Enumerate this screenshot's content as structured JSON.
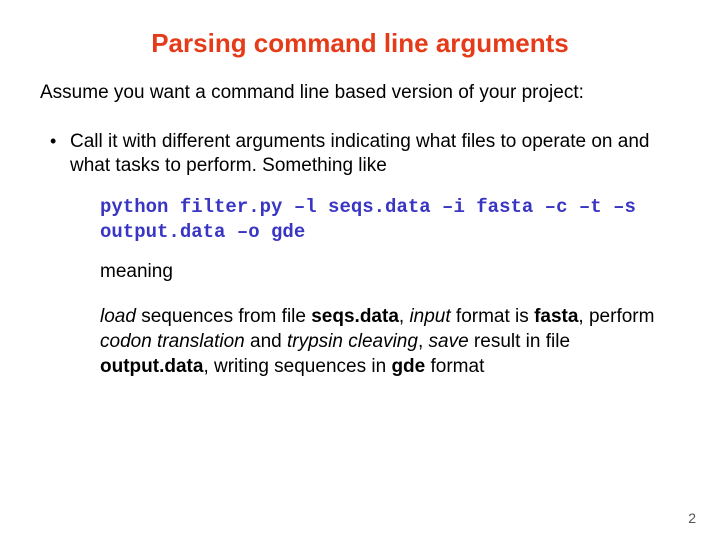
{
  "title": "Parsing command line arguments",
  "intro": "Assume you want a command line based version of your project:",
  "bullet1": "Call it with different arguments indicating what files to operate on and what tasks to perform. Something like",
  "code": "python filter.py –l seqs.data –i fasta –c –t –s output.data –o gde",
  "meaning_label": "meaning",
  "desc": {
    "load": "load",
    "t1": " sequences from file ",
    "seqs": "seqs.data",
    "t2": ", ",
    "input": "input",
    "t3": " format is ",
    "fasta": "fasta",
    "t4": ", perform ",
    "codon": "codon translation",
    "t5": " and ",
    "trypsin": "trypsin cleaving",
    "t6": ", ",
    "save": "save",
    "t7": " result in file ",
    "output": "output.data",
    "t8": ", writing sequences in ",
    "gde": "gde",
    "t9": " format"
  },
  "page_number": "2"
}
